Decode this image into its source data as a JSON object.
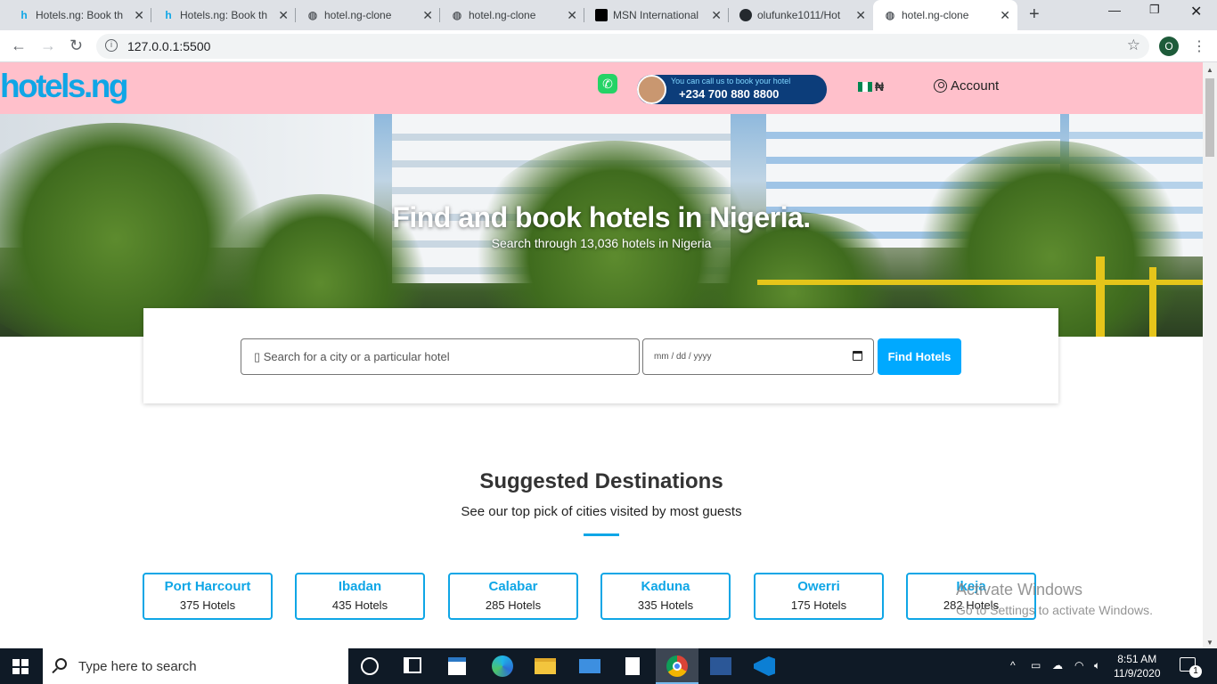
{
  "browser": {
    "tabs": [
      {
        "title": "Hotels.ng: Book th",
        "icon": "hotelsng-h-icon",
        "active": false
      },
      {
        "title": "Hotels.ng: Book th",
        "icon": "hotelsng-h-icon",
        "active": false
      },
      {
        "title": "hotel.ng-clone",
        "icon": "globe-icon",
        "active": false
      },
      {
        "title": "hotel.ng-clone",
        "icon": "globe-icon",
        "active": false
      },
      {
        "title": "MSN International",
        "icon": "msn-icon",
        "active": false
      },
      {
        "title": "olufunke1011/Hot",
        "icon": "github-icon",
        "active": false
      },
      {
        "title": "hotel.ng-clone",
        "icon": "globe-icon",
        "active": true
      }
    ],
    "url": "127.0.0.1:5500",
    "profile_initial": "O"
  },
  "header": {
    "logo": "hotels.ng",
    "call_caption": "You can call us to book your hotel",
    "phone": "+234 700 880 8800",
    "currency": "₦",
    "account_label": "Account"
  },
  "hero": {
    "title": "Find and book hotels in Nigeria.",
    "subtitle": "Search through 13,036 hotels in Nigeria"
  },
  "search": {
    "placeholder": "Search for a city or a particular hotel",
    "date_placeholder": "mm / dd / yyyy",
    "button": "Find Hotels"
  },
  "destinations": {
    "title": "Suggested Destinations",
    "subtitle": "See our top pick of cities visited by most guests",
    "items": [
      {
        "city": "Port Harcourt",
        "count": "375 Hotels"
      },
      {
        "city": "Ibadan",
        "count": "435 Hotels"
      },
      {
        "city": "Calabar",
        "count": "285 Hotels"
      },
      {
        "city": "Kaduna",
        "count": "335 Hotels"
      },
      {
        "city": "Owerri",
        "count": "175 Hotels"
      },
      {
        "city": "Ikeja",
        "count": "282 Hotels"
      }
    ]
  },
  "watermark": {
    "line1": "Activate Windows",
    "line2": "Go to Settings to activate Windows."
  },
  "taskbar": {
    "search_placeholder": "Type here to search",
    "time": "8:51 AM",
    "date": "11/9/2020",
    "notifications": "1"
  },
  "colors": {
    "header_bg": "#ffc0cb",
    "brand_blue": "#0fa6e6",
    "button_blue": "#00a9ff"
  }
}
